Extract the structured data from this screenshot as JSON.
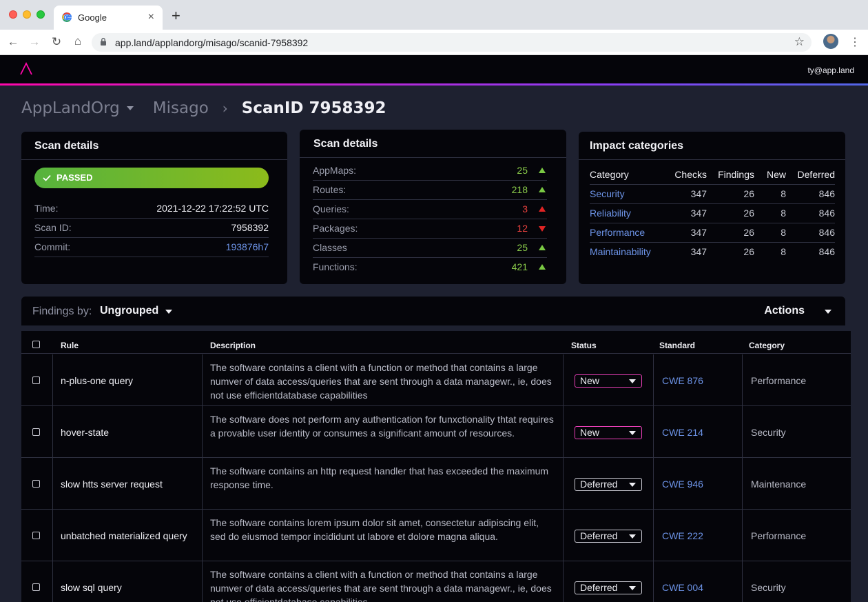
{
  "browser": {
    "tab_title": "Google",
    "url": "app.land/applandorg/misago/scanid-7958392"
  },
  "header": {
    "user_email": "ty@app.land"
  },
  "breadcrumb": {
    "org": "AppLandOrg",
    "project": "Misago",
    "current": "ScanID 7958392"
  },
  "scan_summary": {
    "title": "Scan details",
    "status": "PASSED",
    "time_label": "Time:",
    "time": "2021-12-22 17:22:52 UTC",
    "scan_id_label": "Scan ID:",
    "scan_id": "7958392",
    "commit_label": "Commit:",
    "commit": "193876h7"
  },
  "scan_metrics": {
    "title": "Scan details",
    "items": [
      {
        "label": "AppMaps:",
        "value": "25",
        "trend": "up",
        "color": "#8acb4a"
      },
      {
        "label": "Routes:",
        "value": "218",
        "trend": "up",
        "color": "#8acb4a"
      },
      {
        "label": "Queries:",
        "value": "3",
        "trend": "up",
        "color": "#e8413e"
      },
      {
        "label": "Packages:",
        "value": "12",
        "trend": "down",
        "color": "#e8413e"
      },
      {
        "label": "Classes",
        "value": "25",
        "trend": "up",
        "color": "#8acb4a"
      },
      {
        "label": "Functions:",
        "value": "421",
        "trend": "up",
        "color": "#8acb4a"
      }
    ]
  },
  "impact": {
    "title": "Impact categories",
    "columns": [
      "Category",
      "Checks",
      "Findings",
      "New",
      "Deferred"
    ],
    "rows": [
      {
        "category": "Security",
        "checks": "347",
        "findings": "26",
        "new": "8",
        "deferred": "846"
      },
      {
        "category": "Reliability",
        "checks": "347",
        "findings": "26",
        "new": "8",
        "deferred": "846"
      },
      {
        "category": "Performance",
        "checks": "347",
        "findings": "26",
        "new": "8",
        "deferred": "846"
      },
      {
        "category": "Maintainability",
        "checks": "347",
        "findings": "26",
        "new": "8",
        "deferred": "846"
      }
    ]
  },
  "findings": {
    "group_label": "Findings by:",
    "group_value": "Ungrouped",
    "actions_label": "Actions",
    "columns": {
      "rule": "Rule",
      "description": "Description",
      "status": "Status",
      "standard": "Standard",
      "category": "Category"
    },
    "rows": [
      {
        "rule": "n-plus-one query",
        "description": "The software contains a client with a function or method that contains a large numver of data access/queries that are sent through a data managewr., ie, does not use efficientdatabase capabilities",
        "status": "New",
        "standard": "CWE 876",
        "category": "Performance"
      },
      {
        "rule": "hover-state",
        "description": "The software does not perform any authentication for funxctionality thtat requires a provable user identity or consumes a significant amount of resources.",
        "status": "New",
        "standard": "CWE 214",
        "category": "Security"
      },
      {
        "rule": "slow htts server request",
        "description": "The software contains an http request handler that has exceeded the maximum response time.",
        "status": "Deferred",
        "standard": "CWE 946",
        "category": "Maintenance"
      },
      {
        "rule": "unbatched materialized query",
        "description": "The software contains lorem ipsum dolor sit amet, consectetur adipiscing elit, sed do eiusmod tempor incididunt ut labore et dolore magna aliqua.",
        "status": "Deferred",
        "standard": "CWE 222",
        "category": "Performance"
      },
      {
        "rule": "slow sql query",
        "description": "The software contains a client with a function or method that contains a large numver of data access/queries that are sent through a data managewr., ie, does not use efficientdatabase capabilities",
        "status": "Deferred",
        "standard": "CWE 004",
        "category": "Security"
      }
    ]
  },
  "colors": {
    "accent_pink": "#ff07aa",
    "passed_green": "#8cbb1b",
    "link_blue": "#6d94e8",
    "trend_up": "#7ac943",
    "trend_bad": "#e02424"
  }
}
